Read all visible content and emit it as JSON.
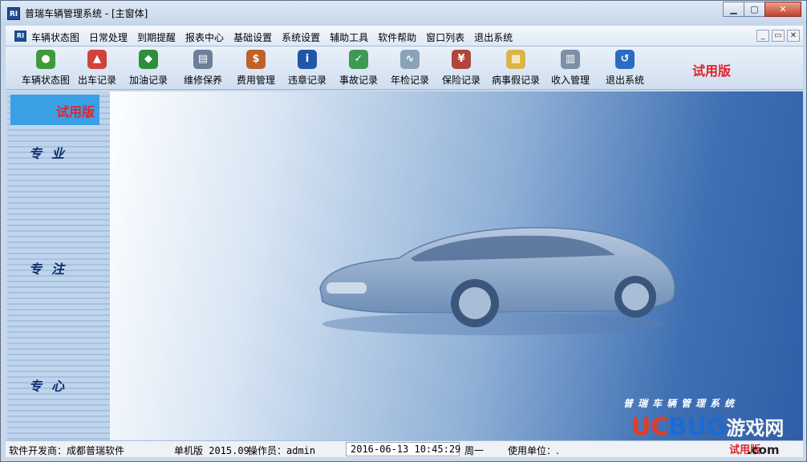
{
  "window": {
    "title": "普瑞车辆管理系统 - [主窗体]",
    "app_icon_text": "RI",
    "min_label": "▁",
    "max_label": "▢",
    "close_label": "✕"
  },
  "menu": {
    "items": [
      "车辆状态图",
      "日常处理",
      "到期提醒",
      "报表中心",
      "基础设置",
      "系统设置",
      "辅助工具",
      "软件帮助",
      "窗口列表",
      "退出系统"
    ],
    "mdi_min": "_",
    "mdi_restore": "▭",
    "mdi_close": "✕"
  },
  "toolbar": {
    "items": [
      {
        "label": "车辆状态图",
        "icon": "vehicle-status-icon",
        "color": "#3f9a3a",
        "glyph": "●"
      },
      {
        "label": "出车记录",
        "icon": "dispatch-icon",
        "color": "#d0433a",
        "glyph": "▲"
      },
      {
        "label": "加油记录",
        "icon": "fuel-icon",
        "color": "#2e8f3a",
        "glyph": "◆"
      },
      {
        "label": "维修保养",
        "icon": "maintenance-icon",
        "color": "#6b7f99",
        "glyph": "▤"
      },
      {
        "label": "费用管理",
        "icon": "expense-icon",
        "color": "#c0602a",
        "glyph": "$"
      },
      {
        "label": "违章记录",
        "icon": "violation-icon",
        "color": "#2257a8",
        "glyph": "i"
      },
      {
        "label": "事故记录",
        "icon": "accident-icon",
        "color": "#3c9a52",
        "glyph": "✓"
      },
      {
        "label": "年检记录",
        "icon": "inspection-icon",
        "color": "#8aa3b8",
        "glyph": "∿"
      },
      {
        "label": "保险记录",
        "icon": "insurance-icon",
        "color": "#b0463b",
        "glyph": "¥"
      },
      {
        "label": "病事假记录",
        "icon": "leave-icon",
        "color": "#d9b54a",
        "glyph": "▦"
      },
      {
        "label": "收入管理",
        "icon": "income-icon",
        "color": "#7c8fa8",
        "glyph": "▥"
      },
      {
        "label": "退出系统",
        "icon": "exit-icon",
        "color": "#2a6cc4",
        "glyph": "↺"
      }
    ],
    "trial": "试用版"
  },
  "sidebar": {
    "trial": "试用版",
    "words": [
      "专业",
      "专注",
      "专心"
    ]
  },
  "main": {
    "brand": "普瑞车辆管理系统",
    "watermark_uc": "UC",
    "watermark_bug": "BUG",
    "watermark_game": "游戏网",
    "watermark_com": ".com"
  },
  "status": {
    "developer": "软件开发商：成都普瑞软件",
    "version": "单机版 2015.09",
    "operator": "操作员：admin",
    "datetime": "2016-06-13 10:45:29",
    "weekday": "周一",
    "unit": "使用单位：.",
    "trial": "试用版"
  }
}
